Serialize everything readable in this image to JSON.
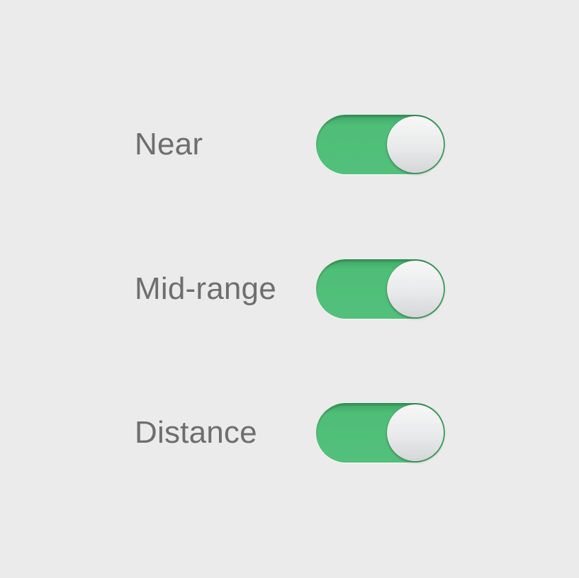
{
  "colors": {
    "background": "#ebebeb",
    "switch_on": "#52c07a",
    "label_text": "#6e6e6e",
    "knob": "#f2f2f2"
  },
  "toggles": [
    {
      "label": "Near",
      "state": "on"
    },
    {
      "label": "Mid-range",
      "state": "on"
    },
    {
      "label": "Distance",
      "state": "on"
    }
  ]
}
